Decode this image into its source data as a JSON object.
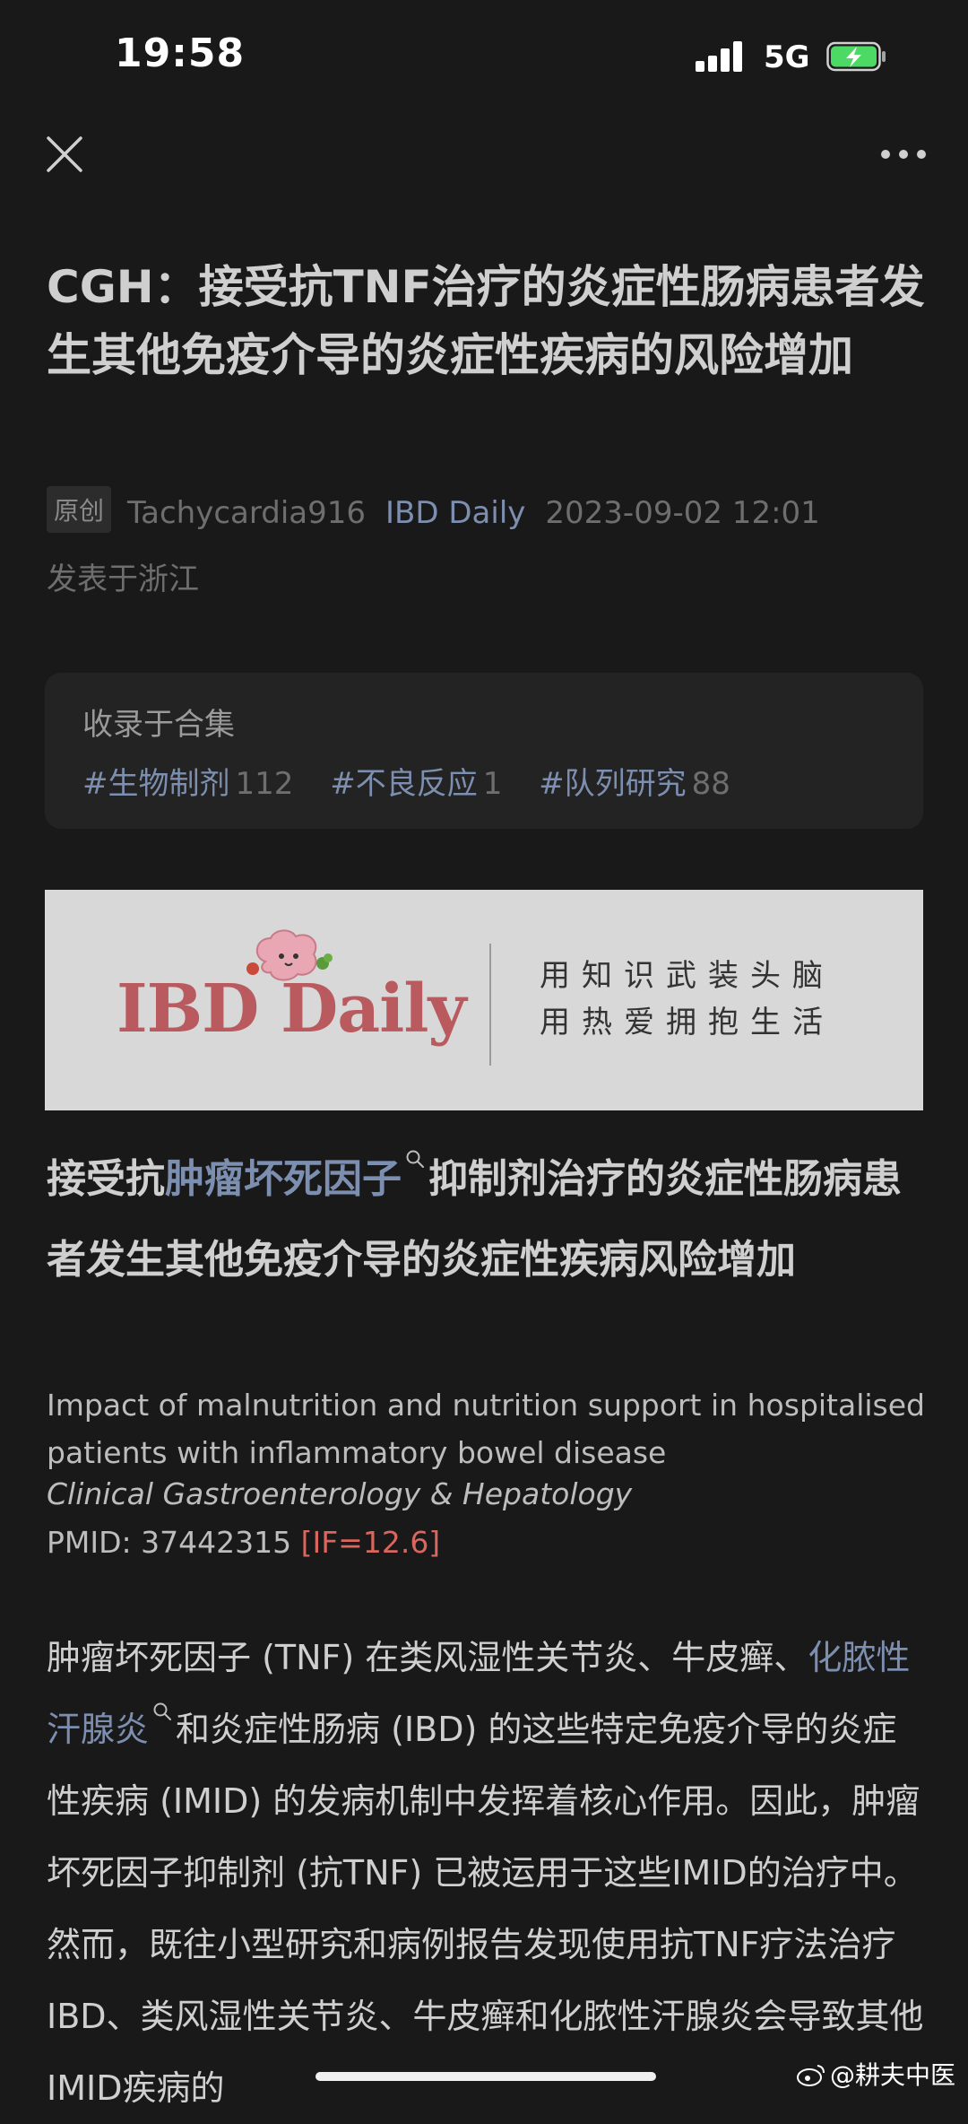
{
  "status_bar": {
    "time": "19:58",
    "network": "5G",
    "battery_color": "#4cd964",
    "icons": [
      "signal-icon",
      "battery-charging-icon"
    ]
  },
  "nav": {
    "icons": [
      "close-icon",
      "more-icon"
    ]
  },
  "article": {
    "title": "CGH：接受抗TNF治疗的炎症性肠病患者发生其他免疫介导的炎症性疾病的风险增加",
    "badge": "原创",
    "author": "Tachycardia916",
    "account": "IBD Daily",
    "date": "2023-09-02 12:01",
    "location": "发表于浙江"
  },
  "collection": {
    "title": "收录于合集",
    "tags": [
      {
        "name": "#生物制剂",
        "count": "112"
      },
      {
        "name": "#不良反应",
        "count": "1"
      },
      {
        "name": "#队列研究",
        "count": "88"
      }
    ]
  },
  "banner": {
    "logo": "IBD Daily",
    "slogan_1": "用知识武装头脑",
    "slogan_2": "用热爱拥抱生活",
    "logo_color": "#b85a5e"
  },
  "heading": {
    "pre": "接受抗",
    "link": "肿瘤坏死因子",
    "post": "抑制剂治疗的炎症性肠病患者发生其他免疫介导的炎症性疾病风险增加"
  },
  "reference": {
    "title": "Impact of malnutrition and nutrition support in hospitalised patients with inflammatory bowel disease",
    "journal": "Clinical Gastroenterology & Hepatology",
    "pmid": "PMID: 37442315",
    "impact": "[IF=12.6]",
    "impact_color": "#d9665f"
  },
  "body": {
    "part1": "肿瘤坏死因子 (TNF) 在类风湿性关节炎、牛皮癣、",
    "link": "化脓性汗腺炎",
    "part2": "和炎症性肠病 (IBD) 的这些特定免疫介导的炎症性疾病 (IMID) 的发病机制中发挥着核心作用。因此，肿瘤坏死因子抑制剂 (抗TNF) 已被运用于这些IMID的治疗中。然而，既往小型研究和病例报告发现使用抗TNF疗法治疗IBD、类风湿性关节炎、牛皮癣和化脓性汗腺炎会导致其他IMID疾病的"
  },
  "watermark": {
    "text": "@耕夫中医"
  }
}
